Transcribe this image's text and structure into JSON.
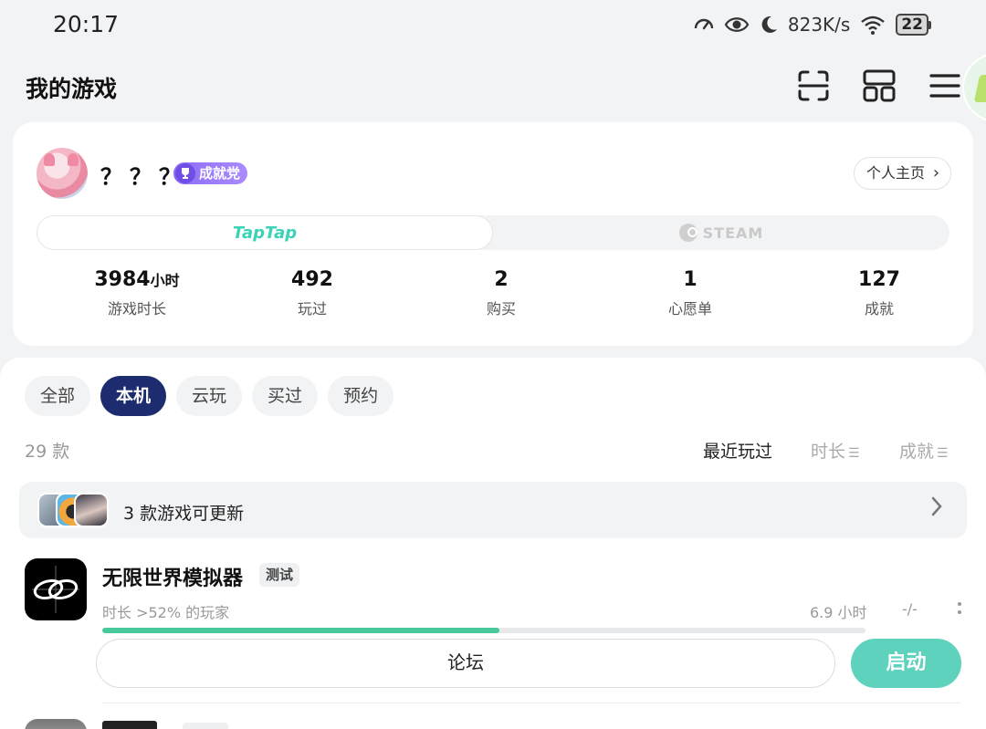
{
  "status_bar": {
    "time": "20:17",
    "net_speed": "823K/s",
    "battery": "22",
    "icons": [
      "speedometer-icon",
      "eye-icon",
      "moon-icon",
      "wifi-icon",
      "battery-icon"
    ]
  },
  "header": {
    "title": "我的游戏",
    "actions": [
      "scan-icon",
      "layout-icon",
      "menu-icon"
    ]
  },
  "profile": {
    "username": "？？？",
    "badge": "成就党",
    "homepage_button": "个人主页",
    "platforms": {
      "taptap": "TapTap",
      "steam": "STEAM",
      "selected": "taptap"
    },
    "stats": [
      {
        "value": "3984",
        "unit": "小时",
        "label": "游戏时长"
      },
      {
        "value": "492",
        "unit": "",
        "label": "玩过"
      },
      {
        "value": "2",
        "unit": "",
        "label": "购买"
      },
      {
        "value": "1",
        "unit": "",
        "label": "心愿单"
      },
      {
        "value": "127",
        "unit": "",
        "label": "成就"
      }
    ]
  },
  "filters": {
    "tabs": [
      "全部",
      "本机",
      "云玩",
      "买过",
      "预约"
    ],
    "active": "本机"
  },
  "list": {
    "count": "29 款",
    "sort_options": [
      "最近玩过",
      "时长",
      "成就"
    ],
    "active_sort": "最近玩过",
    "update_banner": "3 款游戏可更新"
  },
  "games": [
    {
      "title": "无限世界模拟器",
      "tag": "测试",
      "subtitle": "时长 >52% 的玩家",
      "hours": "6.9 小时",
      "achievements": "-/-",
      "progress": 0.52,
      "forum_label": "论坛",
      "launch_label": "启动"
    }
  ],
  "colors": {
    "accent": "#5ed2bd",
    "chip_active": "#1c2c6e",
    "progress": "#48c99a",
    "badge": "#8d6cf4",
    "background": "#f2f3f5"
  }
}
